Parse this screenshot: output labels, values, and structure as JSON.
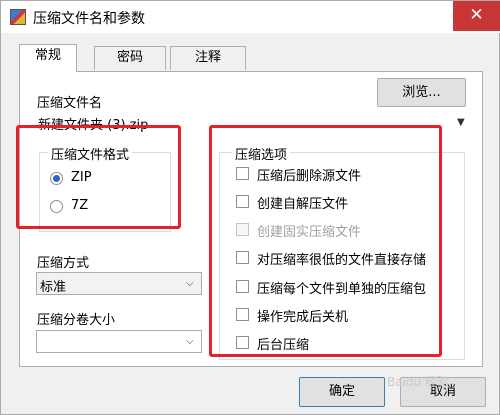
{
  "window": {
    "title": "压缩文件名和参数",
    "close_glyph": "✕"
  },
  "tabs": [
    {
      "label": "常规",
      "active": true
    },
    {
      "label": "密码",
      "active": false
    },
    {
      "label": "注释",
      "active": false
    }
  ],
  "archive": {
    "label": "压缩文件名",
    "value": "新建文件夹 (3).zip",
    "browse_label": "浏览..."
  },
  "format": {
    "title": "压缩文件格式",
    "options": [
      {
        "label": "ZIP",
        "selected": true
      },
      {
        "label": "7Z",
        "selected": false
      }
    ]
  },
  "method": {
    "label": "压缩方式",
    "value": "标准"
  },
  "split": {
    "label": "压缩分卷大小",
    "value": ""
  },
  "options": {
    "title": "压缩选项",
    "items": [
      {
        "label": "压缩后删除源文件",
        "checked": false,
        "enabled": true
      },
      {
        "label": "创建自解压文件",
        "checked": false,
        "enabled": true
      },
      {
        "label": "创建固实压缩文件",
        "checked": false,
        "enabled": false
      },
      {
        "label": "对压缩率很低的文件直接存储",
        "checked": false,
        "enabled": true
      },
      {
        "label": "压缩每个文件到单独的压缩包",
        "checked": false,
        "enabled": true
      },
      {
        "label": "操作完成后关机",
        "checked": false,
        "enabled": true
      },
      {
        "label": "后台压缩",
        "checked": false,
        "enabled": true
      }
    ]
  },
  "footer": {
    "ok_label": "确定",
    "cancel_label": "取消"
  },
  "watermark": "Baidu 经验",
  "colors": {
    "highlight_box": "#e8202a",
    "close_button": "#c83636",
    "radio_dot": "#2a63c8"
  }
}
